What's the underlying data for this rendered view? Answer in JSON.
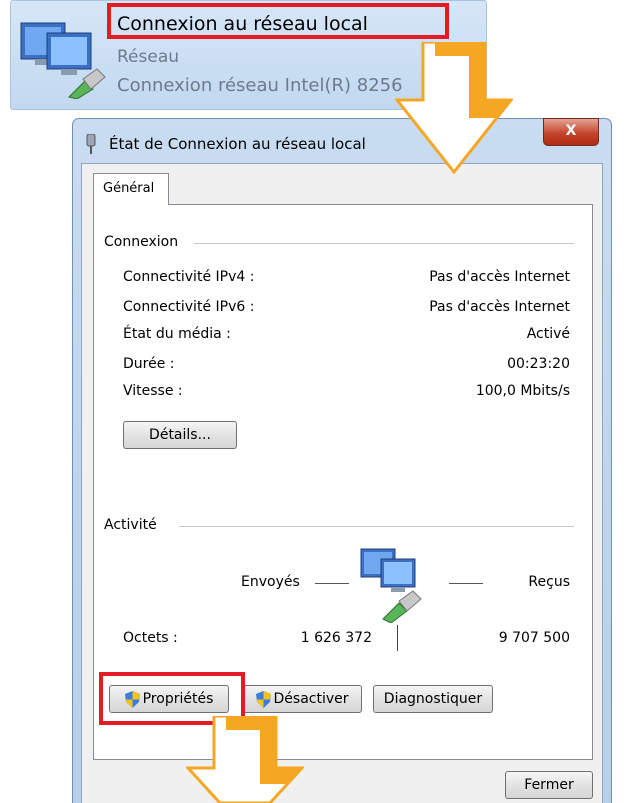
{
  "adapter": {
    "name": "Connexion au réseau local",
    "type": "Réseau",
    "device": "Connexion réseau Intel(R) 8256"
  },
  "dialog": {
    "title": "État de Connexion au réseau local",
    "close_label": "X",
    "tab_general": "Général",
    "connection": {
      "group_label": "Connexion",
      "rows": [
        {
          "label": "Connectivité IPv4 :",
          "value": "Pas d'accès Internet"
        },
        {
          "label": "Connectivité IPv6 :",
          "value": "Pas d'accès Internet"
        },
        {
          "label": "État du média :",
          "value": "Activé"
        },
        {
          "label": "Durée :",
          "value": "00:23:20"
        },
        {
          "label": "Vitesse :",
          "value": "100,0 Mbits/s"
        }
      ],
      "details_button": "Détails..."
    },
    "activity": {
      "group_label": "Activité",
      "sent_label": "Envoyés",
      "received_label": "Reçus",
      "bytes_label": "Octets :",
      "bytes_sent": "1 626 372",
      "bytes_received": "9 707 500"
    },
    "buttons": {
      "properties": "Propriétés",
      "disable": "Désactiver",
      "diagnose": "Diagnostiquer",
      "close": "Fermer"
    }
  },
  "colors": {
    "highlight": "#e41b23",
    "arrow": "#f5a623",
    "window_frame": "#c9dcf1"
  }
}
